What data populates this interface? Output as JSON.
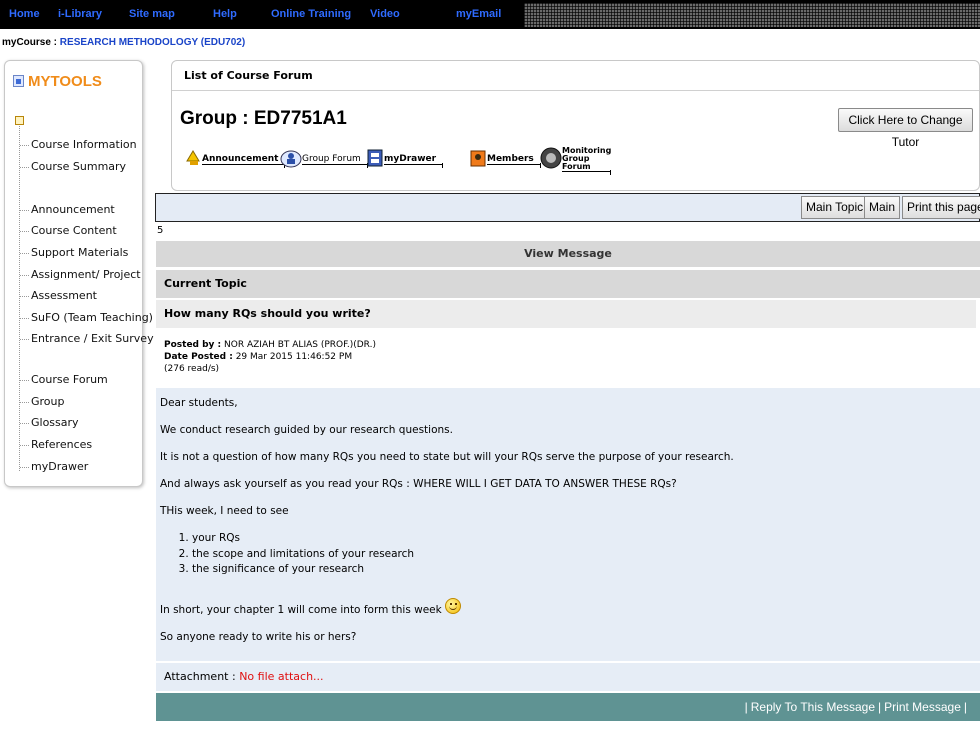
{
  "topnav": {
    "links": [
      "Home",
      "i-Library",
      "Site map",
      "Help",
      "Online Training",
      "Video",
      "myEmail"
    ]
  },
  "course": {
    "label": "myCourse :",
    "name": "RESEARCH METHODOLOGY (EDU702)"
  },
  "sidebar": {
    "title": "MYTOOLS",
    "items": [
      "Course Information",
      "Course Summary",
      "Announcement",
      "Course Content",
      "Support Materials",
      "Assignment/ Project",
      "Assessment",
      "SuFO (Team Teaching)",
      "Entrance / Exit Survey",
      "Course Forum",
      "Group",
      "Glossary",
      "References",
      "myDrawer"
    ]
  },
  "forum": {
    "header": "List of Course Forum",
    "group_title": "Group : ED7751A1",
    "change_tutor_label": "Click Here to Change Tutor",
    "tools": [
      "Announcement",
      "Group Forum",
      "myDrawer",
      "Members",
      "Monitoring Group Forum"
    ]
  },
  "actions": {
    "main_topic": "Main Topic",
    "main": "Main",
    "print_page": "Print this page"
  },
  "stray_number": "5",
  "message": {
    "view_label": "View Message",
    "current_topic_label": "Current Topic",
    "subject": "How many RQs should you write?",
    "posted_by_label": "Posted by :",
    "posted_by": "NOR AZIAH BT ALIAS (PROF.)(DR.)",
    "date_label": "Date Posted :",
    "date": "29 Mar 2015 11:46:52 PM",
    "reads": "(276 read/s)",
    "body": {
      "p1": "Dear students,",
      "p2": "We conduct research guided by our research questions.",
      "p3": "It is not a question of how many RQs you need to state but will your RQs serve the purpose of your research.",
      "p4": "And always ask yourself as you read your RQs : WHERE WILL I GET DATA TO ANSWER THESE RQs?",
      "p5": "THis week, I need to see",
      "list": [
        "your RQs",
        "the scope and limitations of your research",
        "the significance of your research"
      ],
      "p6": "In short, your chapter 1 will come into form this week",
      "p7": "So anyone ready to write his or hers?"
    },
    "attachment_label": "Attachment :",
    "attachment_value": "No file attach...",
    "reply_label": "Reply To This Message",
    "print_label": "Print Message"
  },
  "icons": {
    "sidebar_title": "tools-icon",
    "smiley": "smiley-icon"
  }
}
